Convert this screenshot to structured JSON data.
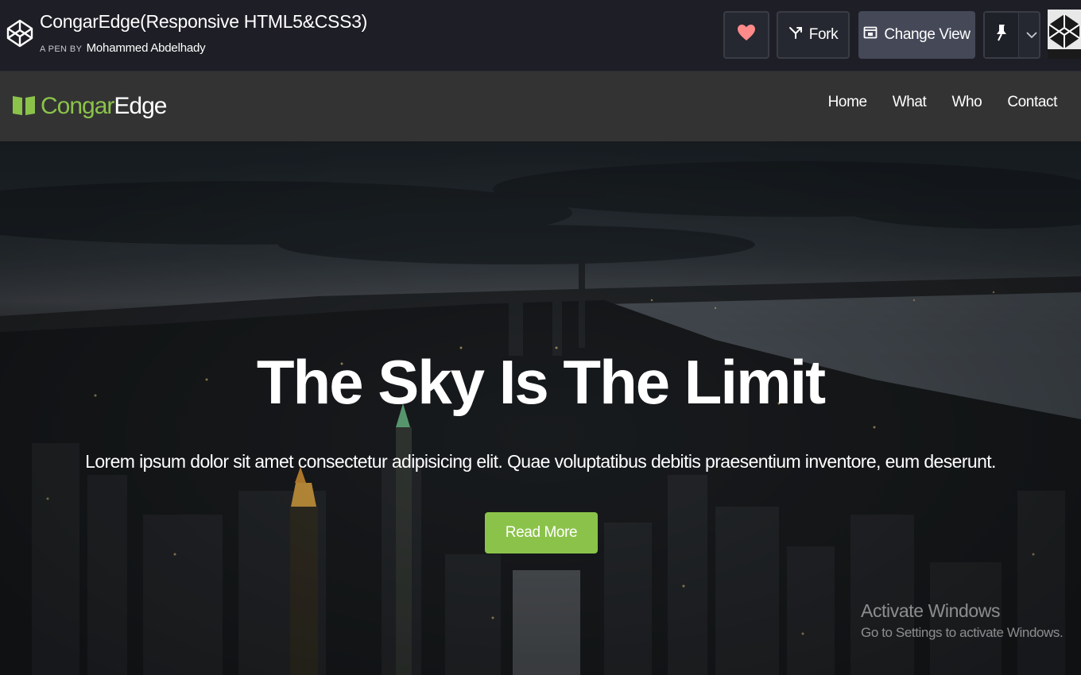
{
  "codepen": {
    "pen_title": "CongarEdge(Responsive HTML5&CSS3)",
    "byline_prefix": "A PEN BY",
    "author": "Mohammed Abdelhady",
    "fork_label": "Fork",
    "change_view_label": "Change View",
    "colors": {
      "bar": "#1e1f26",
      "button": "#252830",
      "heart": "#ff8a8a"
    }
  },
  "site": {
    "brand_green": "Congar",
    "brand_white": "Edge",
    "nav": [
      "Home",
      "What",
      "Who",
      "Contact"
    ],
    "colors": {
      "accent": "#8bc34a",
      "nav_bg": "#333333"
    }
  },
  "hero": {
    "title": "The Sky Is The Limit",
    "subtitle": "Lorem ipsum dolor sit amet consectetur adipisicing elit. Quae voluptatibus debitis praesentium inventore, eum deserunt.",
    "button_label": "Read More"
  },
  "windows_watermark": {
    "title": "Activate Windows",
    "subtitle": "Go to Settings to activate Windows."
  }
}
